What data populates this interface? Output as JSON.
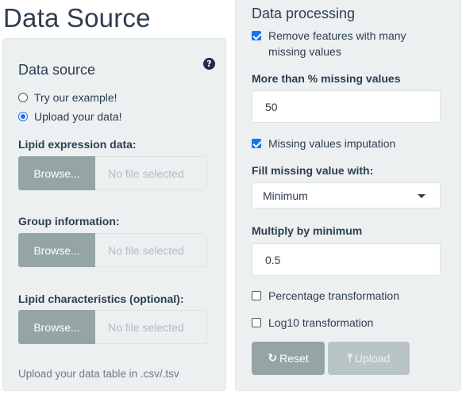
{
  "page": {
    "title": "Data Source"
  },
  "data_source_panel": {
    "title": "Data source",
    "help_icon": "question-circle-icon",
    "radio_options": [
      {
        "label": "Try our example!",
        "checked": false
      },
      {
        "label": "Upload your data!",
        "checked": true
      }
    ],
    "file_inputs": [
      {
        "label": "Lipid expression data:",
        "button": "Browse...",
        "placeholder": "No file selected"
      },
      {
        "label": "Group information:",
        "button": "Browse...",
        "placeholder": "No file selected"
      },
      {
        "label": "Lipid characteristics (optional):",
        "button": "Browse...",
        "placeholder": "No file selected"
      }
    ],
    "help_text": "Upload your data table in .csv/.tsv"
  },
  "processing_panel": {
    "title": "Data processing",
    "remove_missing": {
      "label": "Remove features with many missing values",
      "checked": true
    },
    "missing_pct": {
      "label": "More than % missing values",
      "value": "50"
    },
    "imputation": {
      "label": "Missing values imputation",
      "checked": true
    },
    "fill_with": {
      "label": "Fill missing value with:",
      "value": "Minimum"
    },
    "multiply": {
      "label": "Multiply by minimum",
      "value": "0.5"
    },
    "pct_transform": {
      "label": "Percentage transformation",
      "checked": false
    },
    "log_transform": {
      "label": "Log10 transformation",
      "checked": false
    },
    "reset_button": {
      "label": "Reset",
      "icon": "refresh-icon"
    },
    "upload_button": {
      "label": "Upload",
      "icon": "upload-icon"
    }
  },
  "colors": {
    "panel_bg": "#ecf0f1",
    "text": "#2c3e50",
    "button": "#95a5a6",
    "accent": "#1a73e8"
  }
}
